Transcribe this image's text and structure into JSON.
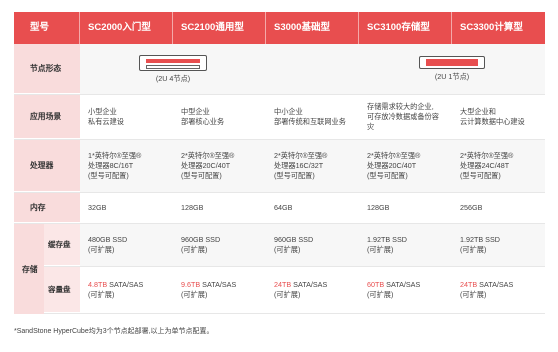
{
  "header": {
    "row_label": "型号",
    "models": [
      "SC2000入门型",
      "SC2100通用型",
      "S3000基础型",
      "SC3100存储型",
      "SC3300计算型"
    ]
  },
  "node_form": {
    "label": "节点形态",
    "caption_left": "(2U 4节点)",
    "caption_right": "(2U 1节点)"
  },
  "scenario": {
    "label": "应用场景",
    "values": [
      [
        "小型企业",
        "私有云建设"
      ],
      [
        "中型企业",
        "部署核心业务"
      ],
      [
        "中小企业",
        "部署传统和互联网业务"
      ],
      [
        "存储需求较大的企业,",
        "可存放冷数据或备份容灾"
      ],
      [
        "大型企业和",
        "云计算数据中心建设"
      ]
    ]
  },
  "cpu": {
    "label": "处理器",
    "values": [
      [
        "1*英特尔®至强®",
        "处理器8C/16T",
        "(型号可配置)"
      ],
      [
        "2*英特尔®至强®",
        "处理器20C/40T",
        "(型号可配置)"
      ],
      [
        "2*英特尔®至强®",
        "处理器16C/32T",
        "(型号可配置)"
      ],
      [
        "2*英特尔®至强®",
        "处理器20C/40T",
        "(型号可配置)"
      ],
      [
        "2*英特尔®至强®",
        "处理器24C/48T",
        "(型号可配置)"
      ]
    ]
  },
  "memory": {
    "label": "内存",
    "values": [
      "32GB",
      "128GB",
      "64GB",
      "128GB",
      "256GB"
    ]
  },
  "storage": {
    "label": "存储",
    "cache": {
      "label": "缓存盘",
      "values": [
        [
          "480GB SSD",
          "(可扩展)"
        ],
        [
          "960GB SSD",
          "(可扩展)"
        ],
        [
          "960GB SSD",
          "(可扩展)"
        ],
        [
          "1.92TB SSD",
          "(可扩展)"
        ],
        [
          "1.92TB SSD",
          "(可扩展)"
        ]
      ]
    },
    "capacity": {
      "label": "容量盘",
      "values": [
        [
          "4.8TB",
          " SATA/SAS",
          "(可扩展)"
        ],
        [
          "9.6TB",
          " SATA/SAS",
          "(可扩展)"
        ],
        [
          "24TB",
          " SATA/SAS",
          "(可扩展)"
        ],
        [
          "60TB",
          " SATA/SAS",
          "(可扩展)"
        ],
        [
          "24TB",
          " SATA/SAS",
          "(可扩展)"
        ]
      ]
    }
  },
  "footnote": "*SandStone HyperCube均为3个节点起部署,以上为单节点配置。",
  "colors": {
    "accent": "#e84e4f",
    "label_bg": "#f9dcdc"
  }
}
